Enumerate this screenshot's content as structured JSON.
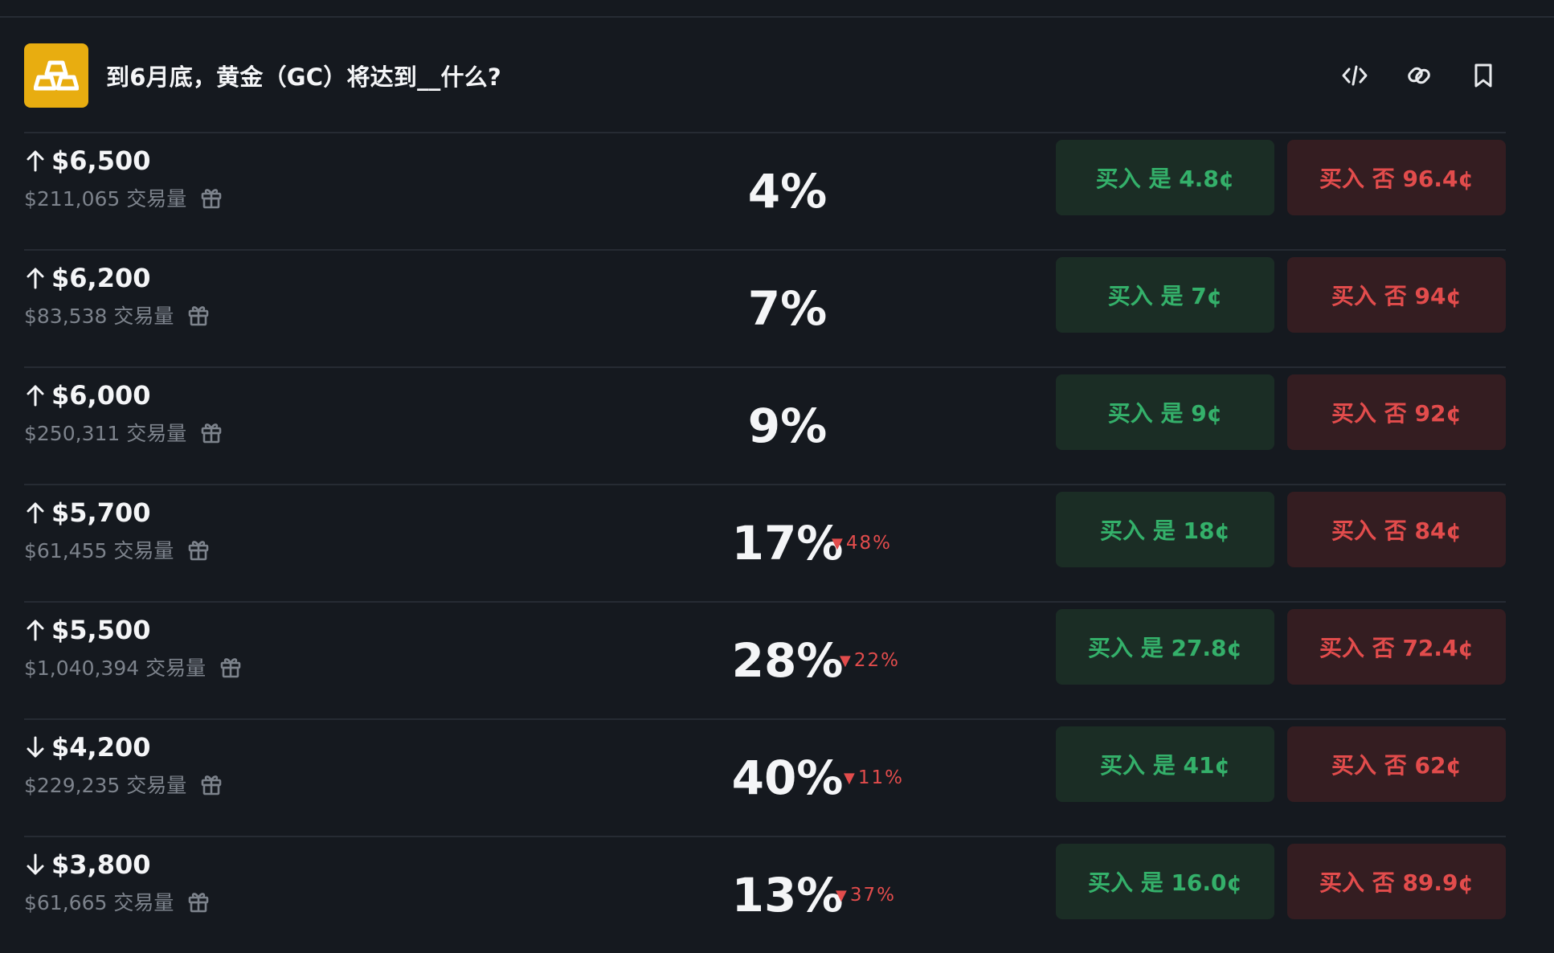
{
  "market": {
    "title": "到6月底，黄金（GC）将达到__什么?",
    "icon": "gold-bars-icon",
    "accent": "#e8ad10"
  },
  "header_actions": [
    {
      "icon": "embed-code-icon"
    },
    {
      "icon": "copy-link-icon"
    },
    {
      "icon": "bookmark-icon"
    }
  ],
  "rows": [
    {
      "direction": "up",
      "strike": "$6,500",
      "volume": "$211,065 交易量",
      "pct": "4%",
      "change": "",
      "yes": "买入 是 4.8¢",
      "no": "买入 否 96.4¢"
    },
    {
      "direction": "up",
      "strike": "$6,200",
      "volume": "$83,538 交易量",
      "pct": "7%",
      "change": "",
      "yes": "买入 是 7¢",
      "no": "买入 否 94¢"
    },
    {
      "direction": "up",
      "strike": "$6,000",
      "volume": "$250,311 交易量",
      "pct": "9%",
      "change": "",
      "yes": "买入 是 9¢",
      "no": "买入 否 92¢"
    },
    {
      "direction": "up",
      "strike": "$5,700",
      "volume": "$61,455 交易量",
      "pct": "17%",
      "change": "48%",
      "yes": "买入 是 18¢",
      "no": "买入 否 84¢"
    },
    {
      "direction": "up",
      "strike": "$5,500",
      "volume": "$1,040,394 交易量",
      "pct": "28%",
      "change": "22%",
      "yes": "买入 是 27.8¢",
      "no": "买入 否 72.4¢"
    },
    {
      "direction": "down",
      "strike": "$4,200",
      "volume": "$229,235 交易量",
      "pct": "40%",
      "change": "11%",
      "yes": "买入 是 41¢",
      "no": "买入 否 62¢"
    },
    {
      "direction": "down",
      "strike": "$3,800",
      "volume": "$61,665 交易量",
      "pct": "13%",
      "change": "37%",
      "yes": "买入 是 16.0¢",
      "no": "买入 否 89.9¢"
    }
  ],
  "colors": {
    "background": "#15191f",
    "yes_bg": "#1b2d25",
    "yes_text": "#34b06a",
    "no_bg": "#341d21",
    "no_text": "#e24c4c",
    "muted": "#7d838c"
  }
}
